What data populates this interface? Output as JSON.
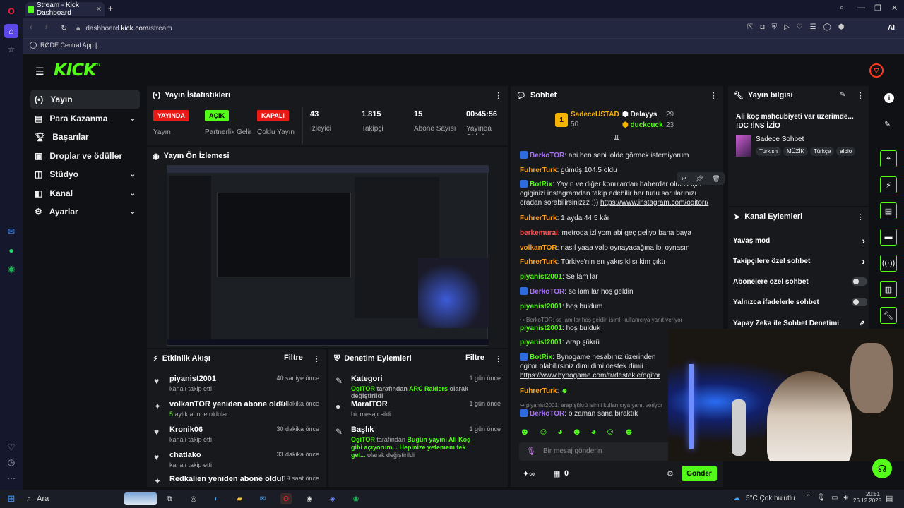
{
  "browser": {
    "tab_title": "Stream - Kick Dashboard",
    "url_prefix": "dashboard.",
    "url_domain": "kick.com",
    "url_path": "/stream",
    "bookmark": "RØDE Central App |...",
    "ai_label": "AI"
  },
  "nav": {
    "logo": "KICK",
    "beta": "BETA",
    "items": [
      {
        "label": "Yayın",
        "active": true
      },
      {
        "label": "Para Kazanma"
      },
      {
        "label": "Başarılar"
      },
      {
        "label": "Droplar ve ödüller"
      },
      {
        "label": "Stüdyo"
      },
      {
        "label": "Kanal"
      },
      {
        "label": "Ayarlar"
      }
    ]
  },
  "stats": {
    "title": "Yayın İstatistikleri",
    "live_badge": "YAYINDA",
    "live_label": "Yayın",
    "partner_badge": "AÇIK",
    "partner_label": "Partnerlik Gelir",
    "multi_badge": "KAPALI",
    "multi_label": "Çoklu Yayın",
    "viewers": "43",
    "viewers_label": "İzleyici",
    "followers": "1.815",
    "followers_label": "Takipçi",
    "subs": "15",
    "subs_label": "Abone Sayısı",
    "uptime": "00:45:56",
    "uptime_label": "Yayında Olduğu"
  },
  "preview": {
    "title": "Yayın Ön İzlemesi"
  },
  "activity": {
    "title": "Etkinlik Akışı",
    "filter": "Filtre",
    "items": [
      {
        "title": "piyanist2001",
        "sub": "kanalı takip etti",
        "time": "40 saniye önce"
      },
      {
        "title": "volkanTOR yeniden abone oldu!",
        "sub_num": "5",
        "sub": " aylık abone oldular",
        "time": "8 dakika önce"
      },
      {
        "title": "Kronik06",
        "sub": "kanalı takip etti",
        "time": "30 dakika önce"
      },
      {
        "title": "chatlako",
        "sub": "kanalı takip etti",
        "time": "33 dakika önce"
      },
      {
        "title": "Redkalien yeniden abone oldu!",
        "sub": "",
        "time": "19 saat önce"
      }
    ]
  },
  "moderation": {
    "title": "Denetim Eylemleri",
    "filter": "Filtre",
    "items": [
      {
        "title": "Kategori",
        "time": "1 gün önce",
        "user": "OgiTOR",
        "mid": " tarafından ",
        "val": "ARC Raiders",
        "end": " olarak değiştirildi"
      },
      {
        "title": "MaraITOR",
        "time": "1 gün önce",
        "plain": "bir mesajı sildi"
      },
      {
        "title": "Başlık",
        "time": "1 gün önce",
        "user": "OgiTOR",
        "mid": " tarafından ",
        "val": "Bugün yayını Ali Koç gibi açıyorum... Hepinize yetemem tek gel...",
        "end": " olarak değiştirildi"
      }
    ]
  },
  "chat": {
    "title": "Sohbet",
    "leader1_name": "SadeceUSTAD",
    "leader1_pts": "50",
    "leader2_name": "Delayys",
    "leader2_pts": "29",
    "leader3_name": "duckcuck",
    "leader3_pts": "23",
    "lines": [
      {
        "user": "BerkoTOR",
        "text": ": abi ben seni lolde görmek istemiyorum"
      },
      {
        "user": "FuhrerTurk",
        "text": ": gümüş 104.5 oldu"
      },
      {
        "user": "BotRix",
        "text": ": Yayın ve diğer konulardan haberdar olmak için ogiginizi instagramdan takip edebilir her türlü sorularınızı oradan sorabilirsinizzz :))",
        "link": "https://www.instagram.com/ogitorr/"
      },
      {
        "user": "FuhrerTurk",
        "text": ": 1 ayda 44.5 kâr"
      },
      {
        "user": "berkemurai",
        "text": ": metroda izliyom abi geç geliyo bana baya"
      },
      {
        "user": "volkanTOR",
        "text": ": nasıl yaaa valo oynayacağına lol oynasın"
      },
      {
        "user": "FuhrerTurk",
        "text": ": Türkiye'nin en yakışıklısı kim çıktı"
      },
      {
        "user": "piyanist2001",
        "text": ": Se lam lar"
      },
      {
        "user": "BerkoTOR",
        "text": ": se lam lar hoş geldin"
      },
      {
        "user": "piyanist2001",
        "text": ": hoş buldum"
      },
      {
        "reply": "BerkoTOR: se lam lar hoş geldin isimli kullanıcıya yanıt veriyor"
      },
      {
        "user": "piyanist2001",
        "text": ": hoş bulduk"
      },
      {
        "user": "piyanist2001",
        "text": ": arap şükrü"
      },
      {
        "user": "BotRix",
        "text": ": Bynogame hesabınız üzerinden ogitor olabilirsiniz dimi dimi destek dimii ;",
        "link": "https://www.bynogame.com/tr/destekle/ogitor"
      },
      {
        "user": "FuhrerTurk",
        "text": ":"
      },
      {
        "reply": "piyanist2001: arap şükrü isimli kullanıcıya yanıt veriyor"
      },
      {
        "user": "BerkoTOR",
        "text": ": o zaman sana bıraktık"
      }
    ],
    "input_placeholder": "Bir mesaj gönderin",
    "points": "0",
    "send": "Gönder"
  },
  "info": {
    "title": "Yayın bilgisi",
    "stream_title": "Ali koç mahcubiyeti var üzerimde... !DC !İNS İZİO",
    "category": "Sadece Sohbet",
    "tags": [
      "Turkish",
      "MÜZİK",
      "Türkçe",
      "albio"
    ]
  },
  "actions": {
    "title": "Kanal Eylemleri",
    "slow": "Yavaş mod",
    "followers_only": "Takipçilere özel sohbet",
    "subs_only": "Abonelere özel sohbet",
    "emote_only": "Yalnızca ifadelerle sohbet",
    "ai_mod": "Yapay Zeka ile Sohbet Denetimi"
  },
  "taskbar": {
    "search": "Ara",
    "weather": "5°C  Çok bulutlu",
    "time": "20:51",
    "date": "26.12.2025"
  },
  "colors": {
    "accent": "#53fc18",
    "live": "#e91916",
    "bg": "#0f1114"
  }
}
